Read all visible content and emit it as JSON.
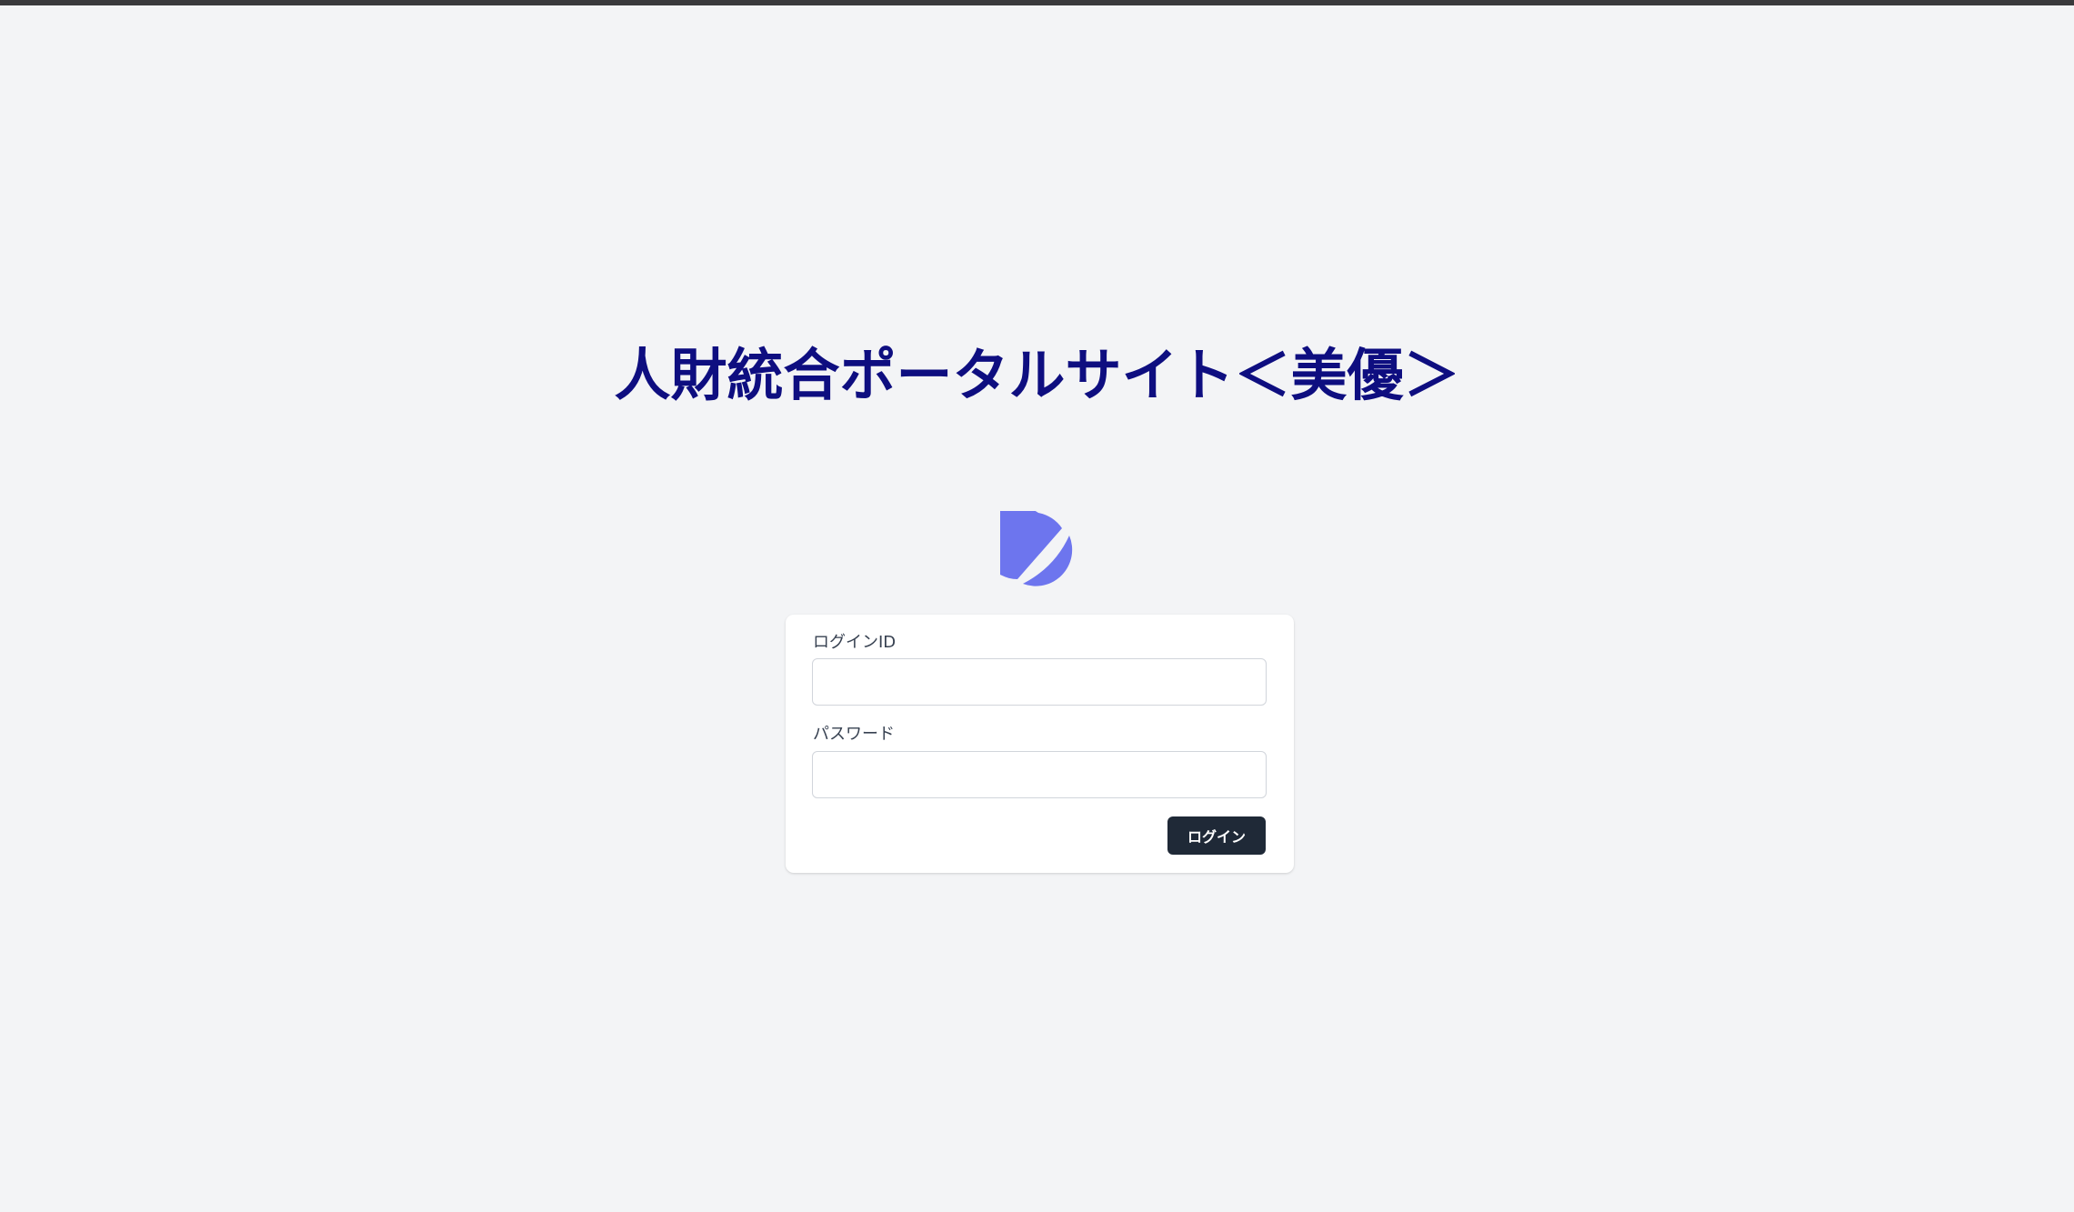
{
  "header": {
    "title": "人財統合ポータルサイト＜美優＞"
  },
  "logo": {
    "icon": "moon-logo-icon",
    "color": "#6d75ee"
  },
  "login_form": {
    "login_id_label": "ログインID",
    "login_id_value": "",
    "password_label": "パスワード",
    "password_value": "",
    "submit_label": "ログイン"
  },
  "colors": {
    "background": "#f3f4f6",
    "title": "#0e0e80",
    "button": "#1f2937",
    "button_text": "#ffffff",
    "card": "#ffffff"
  }
}
